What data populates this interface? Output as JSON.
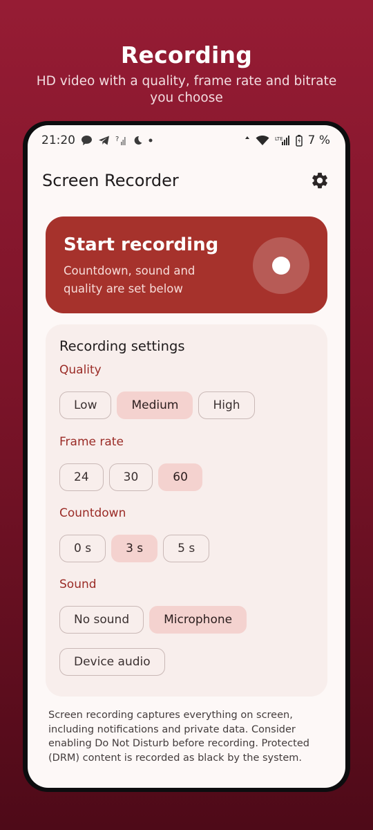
{
  "promo": {
    "title": "Recording",
    "subtitle": "HD video with a quality, frame rate and bitrate you choose"
  },
  "status_bar": {
    "time": "21:20",
    "network_label": "LTE",
    "battery": "7 %",
    "icons_left": [
      "chat-bubble-icon",
      "telegram-icon",
      "signal-unknown-icon",
      "dnd-moon-icon",
      "dot-icon"
    ],
    "icons_right": [
      "data-arrows-icon",
      "wifi-icon",
      "signal-icon",
      "battery-icon"
    ]
  },
  "app_bar": {
    "title": "Screen Recorder",
    "settings_icon": "gear-icon"
  },
  "start_card": {
    "title": "Start recording",
    "description": "Countdown, sound and quality are set below",
    "color": "#a6322c"
  },
  "settings": {
    "title": "Recording settings",
    "quality": {
      "label": "Quality",
      "options": [
        "Low",
        "Medium",
        "High"
      ],
      "selected": "Medium"
    },
    "frame_rate": {
      "label": "Frame rate",
      "options": [
        "24",
        "30",
        "60"
      ],
      "selected": "60"
    },
    "countdown": {
      "label": "Countdown",
      "options": [
        "0 s",
        "3 s",
        "5 s"
      ],
      "selected": "3 s"
    },
    "sound": {
      "label": "Sound",
      "options": [
        "No sound",
        "Microphone",
        "Device audio"
      ],
      "selected": "Microphone"
    }
  },
  "disclaimer": "Screen recording captures everything on screen, including notifications and private data. Consider enabling Do Not Disturb before recording. Protected (DRM) content is recorded as black by the system.",
  "colors": {
    "accent": "#a6322c",
    "chip_selected": "#f4d2cf",
    "label": "#9a2b26",
    "background_top": "#961c34",
    "background_bottom": "#4e0a18"
  }
}
